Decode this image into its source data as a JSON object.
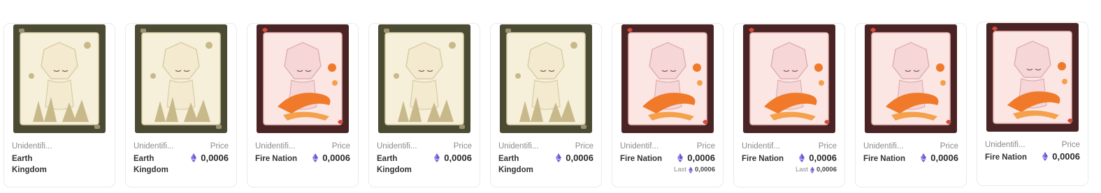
{
  "marketplace": {
    "price_label": "Price",
    "currency_icon": "ethereum-icon",
    "last_label": "Last",
    "cards": [
      {
        "name": "Unidentifi...",
        "nation": "Earth Kingdom",
        "theme": "earth",
        "price": "",
        "price_label": "",
        "last": ""
      },
      {
        "name": "Unidentifi...",
        "nation": "Earth Kingdom",
        "theme": "earth",
        "price": "0,0006",
        "price_label": "Price",
        "last": ""
      },
      {
        "name": "Unidentifi...",
        "nation": "Fire Nation",
        "theme": "fire",
        "price": "0,0006",
        "price_label": "Price",
        "last": ""
      },
      {
        "name": "Unidentifi...",
        "nation": "Earth Kingdom",
        "theme": "earth",
        "price": "0,0006",
        "price_label": "Price",
        "last": ""
      },
      {
        "name": "Unidentifi...",
        "nation": "Earth Kingdom",
        "theme": "earth",
        "price": "0,0006",
        "price_label": "Price",
        "last": ""
      },
      {
        "name": "Unidentif...",
        "nation": "Fire Nation",
        "theme": "fire",
        "price": "0,0006",
        "price_label": "Price",
        "last": "0,0006"
      },
      {
        "name": "Unidentif...",
        "nation": "Fire Nation",
        "theme": "fire",
        "price": "0,0006",
        "price_label": "Price",
        "last": "0,0006"
      },
      {
        "name": "Unidentifi...",
        "nation": "Fire Nation",
        "theme": "fire",
        "price": "0,0006",
        "price_label": "Price",
        "last": ""
      },
      {
        "name": "Unidentifi...",
        "nation": "Fire Nation",
        "theme": "fire",
        "price": "0,0006",
        "price_label": "Price",
        "last": ""
      }
    ]
  },
  "colors": {
    "earth_frame": "#4b4a33",
    "earth_bg": "#f6efd9",
    "earth_figure": "#f3ead0",
    "earth_rock": "#c8b98a",
    "fire_frame": "#4a2424",
    "fire_bg": "#fbe6e4",
    "fire_figure": "#f6d6d6",
    "fire_flame": "#f07a2a",
    "eth_purple": "#6a4fd0"
  }
}
